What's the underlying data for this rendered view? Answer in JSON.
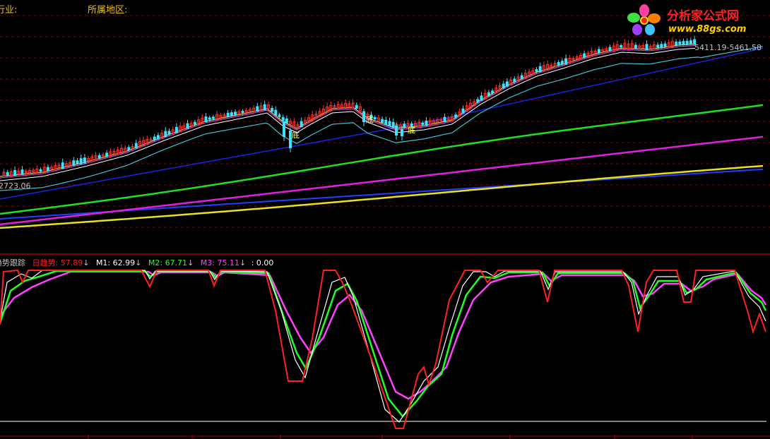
{
  "header": {
    "industry_label": "行业:",
    "region_label": "所属地区:"
  },
  "logo": {
    "title": "分析家公式网",
    "url": "www.88gs.com"
  },
  "price_panel": {
    "range_label": "5411.19-5461.58",
    "low_label": "2723.06",
    "bottom_markers": [
      "底",
      "底",
      "底"
    ],
    "colors": {
      "up": "#ff3030",
      "down": "#40e0ff",
      "ma1": "#ffffff",
      "ma2": "#ffff40",
      "ma3": "#ff40ff",
      "ma4": "#40ff40",
      "ma_cyan": "#40c0d0",
      "ma_green": "#20e020",
      "ma_magenta": "#e020e0",
      "ma_yellow": "#e8e020",
      "ma_blue": "#2020e0",
      "ma_blue2": "#2040ff"
    }
  },
  "indicator_panel": {
    "name": "趋势跟踪",
    "series": [
      {
        "label": "日趋势:",
        "value": "57.89",
        "arrow": "↓",
        "color": "#ff2020"
      },
      {
        "label": "M1:",
        "value": "62.99",
        "arrow": "↓",
        "color": "#ffffff"
      },
      {
        "label": "M2:",
        "value": "67.71",
        "arrow": "↓",
        "color": "#20ff20"
      },
      {
        "label": "M3:",
        "value": "75.11",
        "arrow": "↓",
        "color": "#ff40ff"
      }
    ],
    "extra": ": 0.00"
  }
}
